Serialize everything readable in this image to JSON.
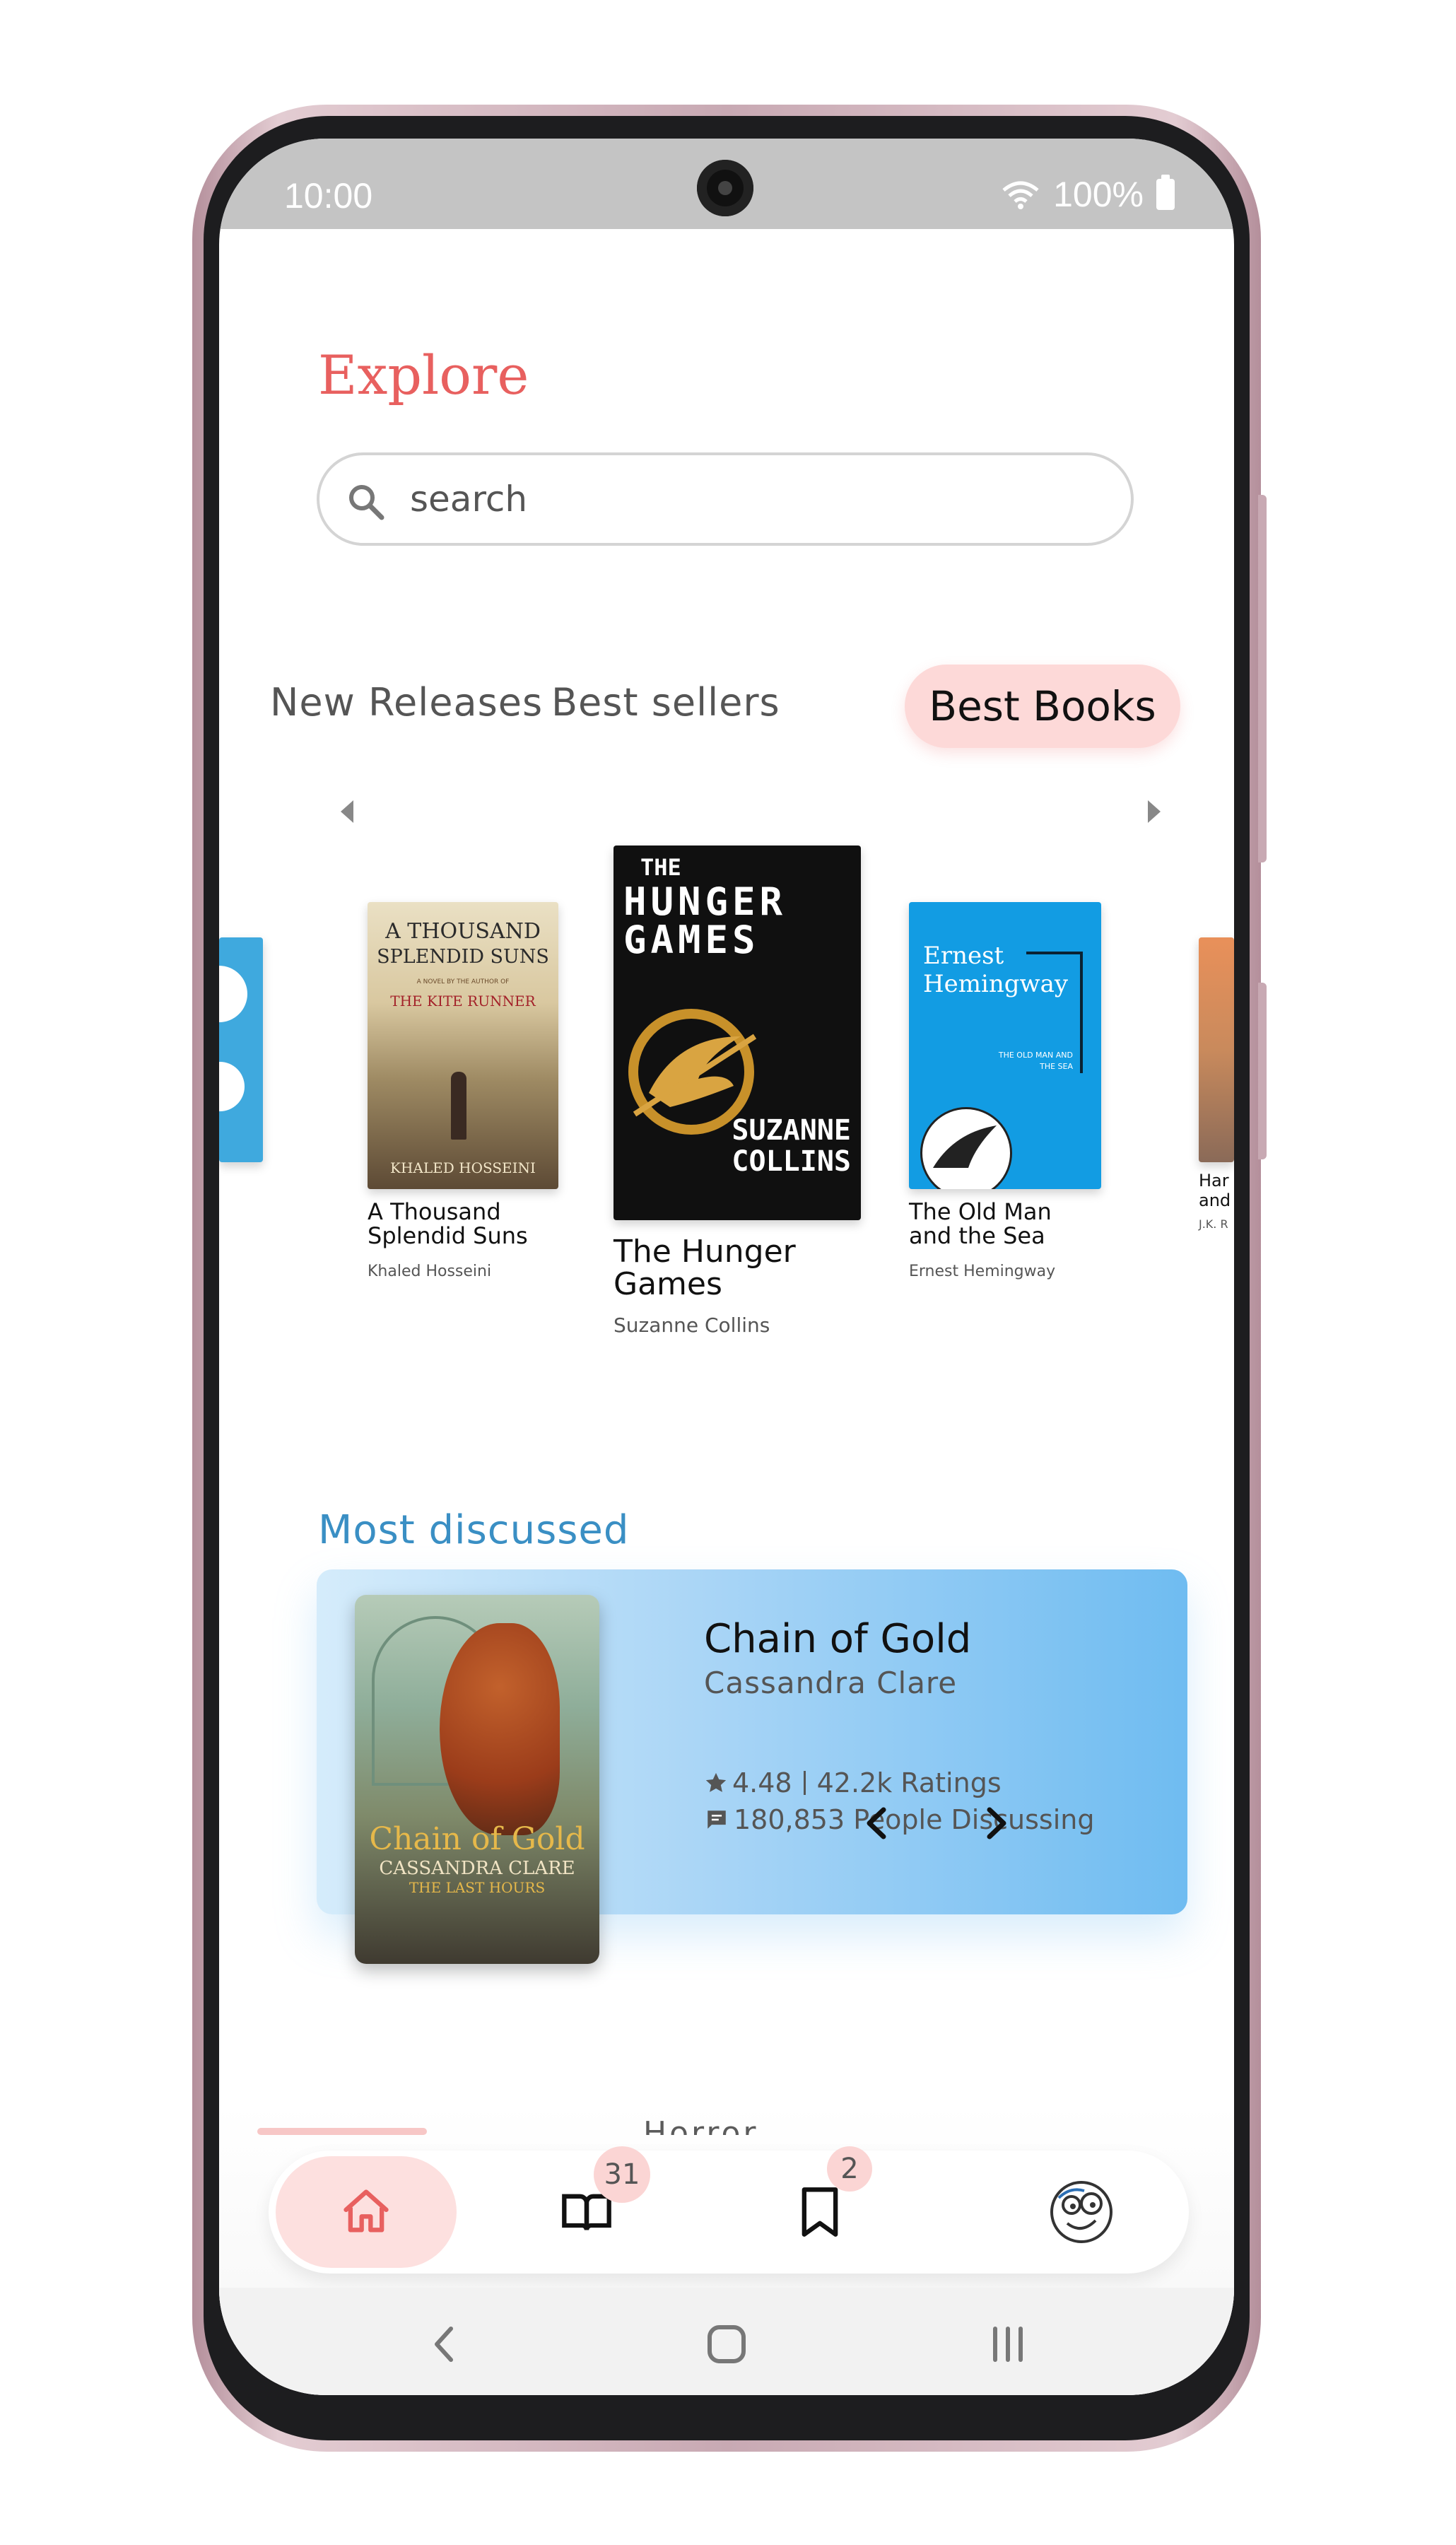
{
  "status_bar": {
    "time": "10:00",
    "battery": "100%"
  },
  "header": {
    "title": "Explore"
  },
  "search": {
    "placeholder": "search"
  },
  "tabs": [
    {
      "label": "New Releases",
      "active": false
    },
    {
      "label": "Best sellers",
      "active": false
    },
    {
      "label": "Best Books",
      "active": true
    }
  ],
  "carousel": {
    "books": [
      {
        "title": "A Thousand Splendid Suns",
        "author": "Khaled Hosseini",
        "cover": {
          "line1": "A THOUSAND",
          "line2": "SPLENDID SUNS",
          "tagline": "A NOVEL BY THE AUTHOR OF",
          "sub": "THE KITE RUNNER",
          "author": "KHALED HOSSEINI"
        }
      },
      {
        "title": "The Hunger Games",
        "author": "Suzanne Collins",
        "cover": {
          "the": "THE",
          "line1": "HUNGER",
          "line2": "GAMES",
          "author_line1": "SUZANNE",
          "author_line2": "COLLINS"
        }
      },
      {
        "title": "The Old Man and the Sea",
        "author": "Ernest Hemingway",
        "cover": {
          "author_line1": "Ernest",
          "author_line2": "Hemingway",
          "title_line1": "THE OLD MAN AND",
          "title_line2": "THE SEA"
        }
      }
    ],
    "peek_right": {
      "title_line1": "Har",
      "title_line2": "and",
      "author": "J.K. R"
    }
  },
  "most_discussed": {
    "section_title": "Most discussed",
    "book": {
      "title": "Chain of Gold",
      "author": "Cassandra Clare",
      "rating": "4.48",
      "ratings_count": "42.2k Ratings",
      "discussing": "180,853 People Discussing",
      "cover": {
        "title": "Chain of Gold",
        "author": "CASSANDRA CLARE",
        "series": "THE LAST HOURS"
      }
    }
  },
  "peek_section": {
    "label": "Horror"
  },
  "bottom_nav": {
    "library_badge": "31",
    "saved_badge": "2"
  },
  "colors": {
    "accent": "#e8605f",
    "accent_soft": "#fdd9d8",
    "section_blue": "#3a8fc4",
    "card_blue": "#6fbcf1"
  }
}
